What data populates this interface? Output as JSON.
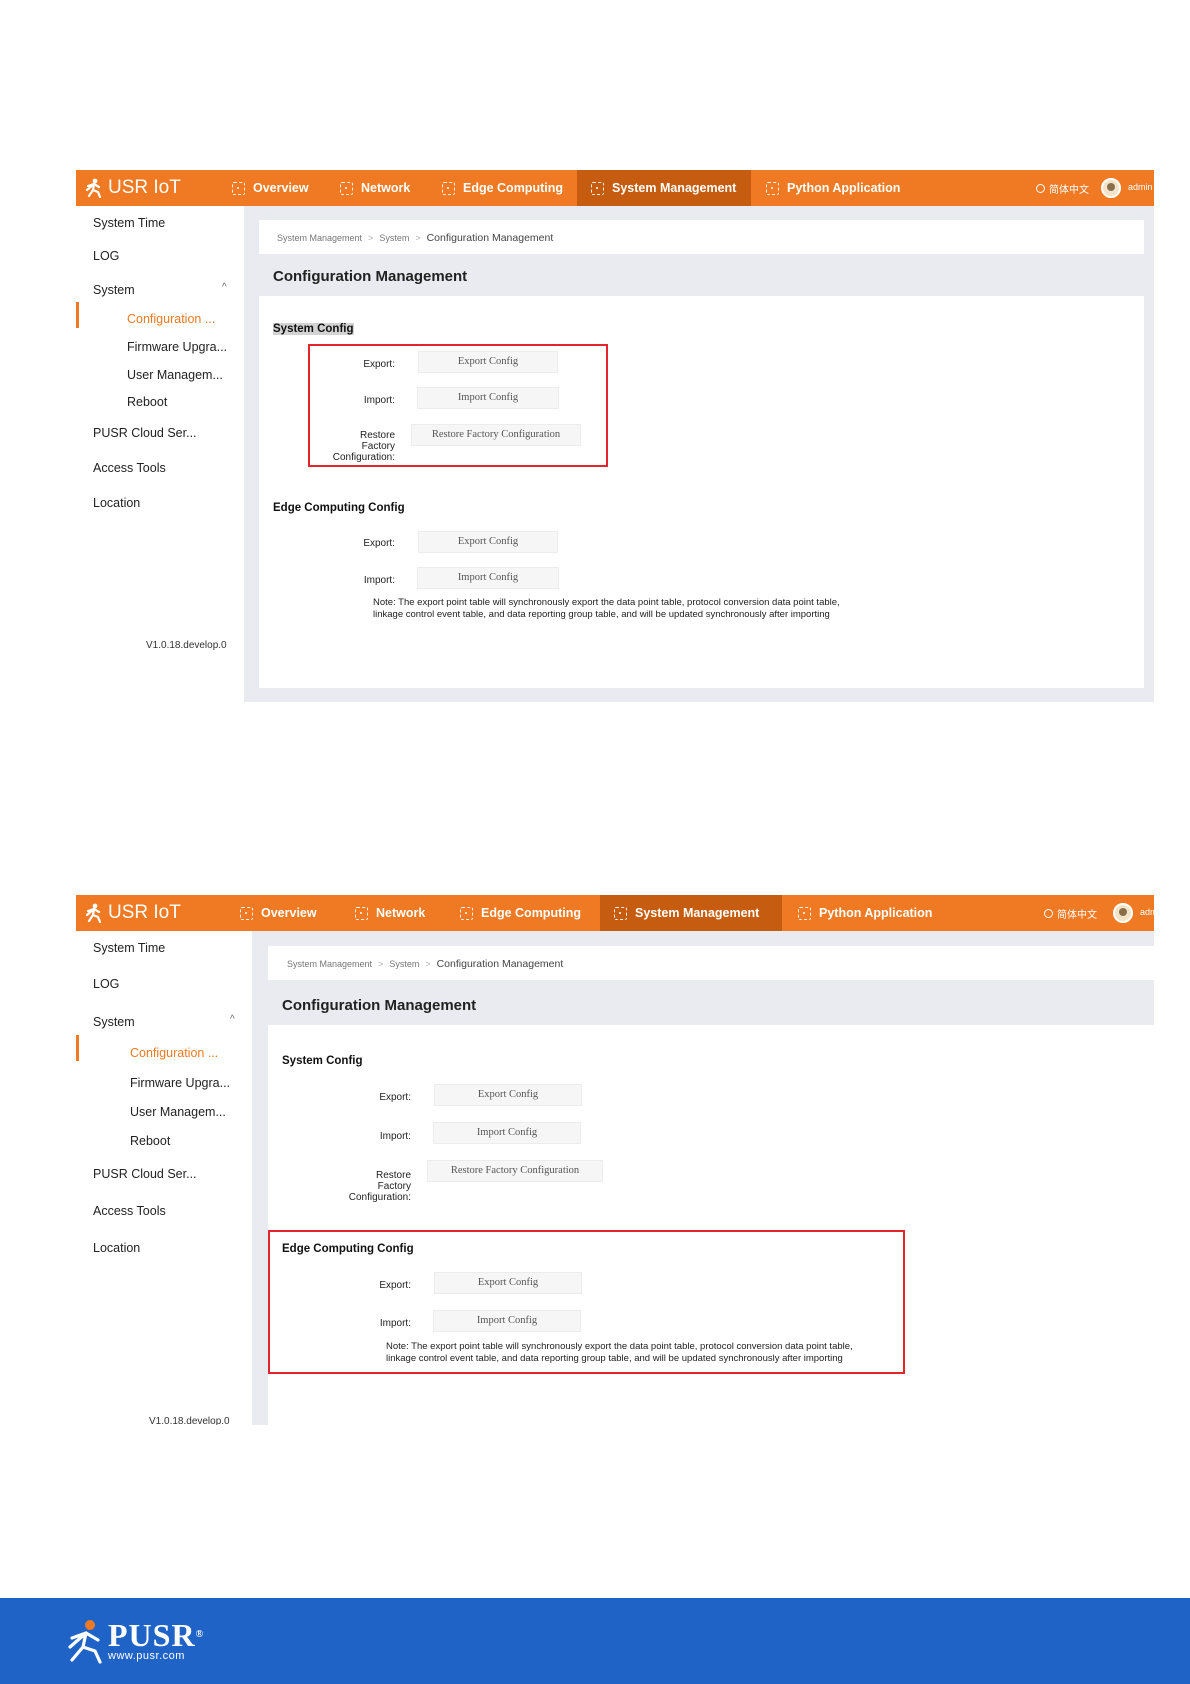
{
  "app": {
    "brand": "USR IoT"
  },
  "nav": {
    "overview": "Overview",
    "network": "Network",
    "edge_computing": "Edge Computing",
    "system_management": "System Management",
    "python_application": "Python Application",
    "language": "简体中文",
    "user": "admin"
  },
  "sidebar": {
    "system_time": "System Time",
    "log": "LOG",
    "system": "System",
    "configuration": "Configuration ...",
    "firmware": "Firmware Upgra...",
    "user_mgmt": "User Managem...",
    "reboot": "Reboot",
    "pusr_cloud": "PUSR Cloud Ser...",
    "access_tools": "Access Tools",
    "location": "Location",
    "version": "V1.0.18.develop.0"
  },
  "breadcrumb": {
    "level1": "System Management",
    "level2": "System",
    "current": "Configuration Management"
  },
  "page": {
    "title": "Configuration Management",
    "system_config": {
      "heading": "System Config",
      "export_label": "Export:",
      "export_button": "Export Config",
      "import_label": "Import:",
      "import_button": "Import Config",
      "restore_label_line1": "Restore",
      "restore_label_line2": "Factory",
      "restore_label_line3": "Configuration:",
      "restore_button": "Restore Factory Configuration"
    },
    "edge_config": {
      "heading": "Edge Computing Config",
      "export_label": "Export:",
      "export_button": "Export Config",
      "import_label": "Import:",
      "import_button": "Import Config",
      "note_line1": "Note: The export point table will synchronously export the data point table, protocol conversion data point table,",
      "note_line2": "linkage control event table, and data reporting group table, and will be updated synchronously after importing"
    }
  },
  "footer": {
    "logo_text": "PUSR",
    "url": "www.pusr.com",
    "reg": "®"
  },
  "colors": {
    "accent": "#ef7a23",
    "nav_active": "#c65c10",
    "highlight_box": "#e4262c",
    "footer": "#1f63c7"
  }
}
